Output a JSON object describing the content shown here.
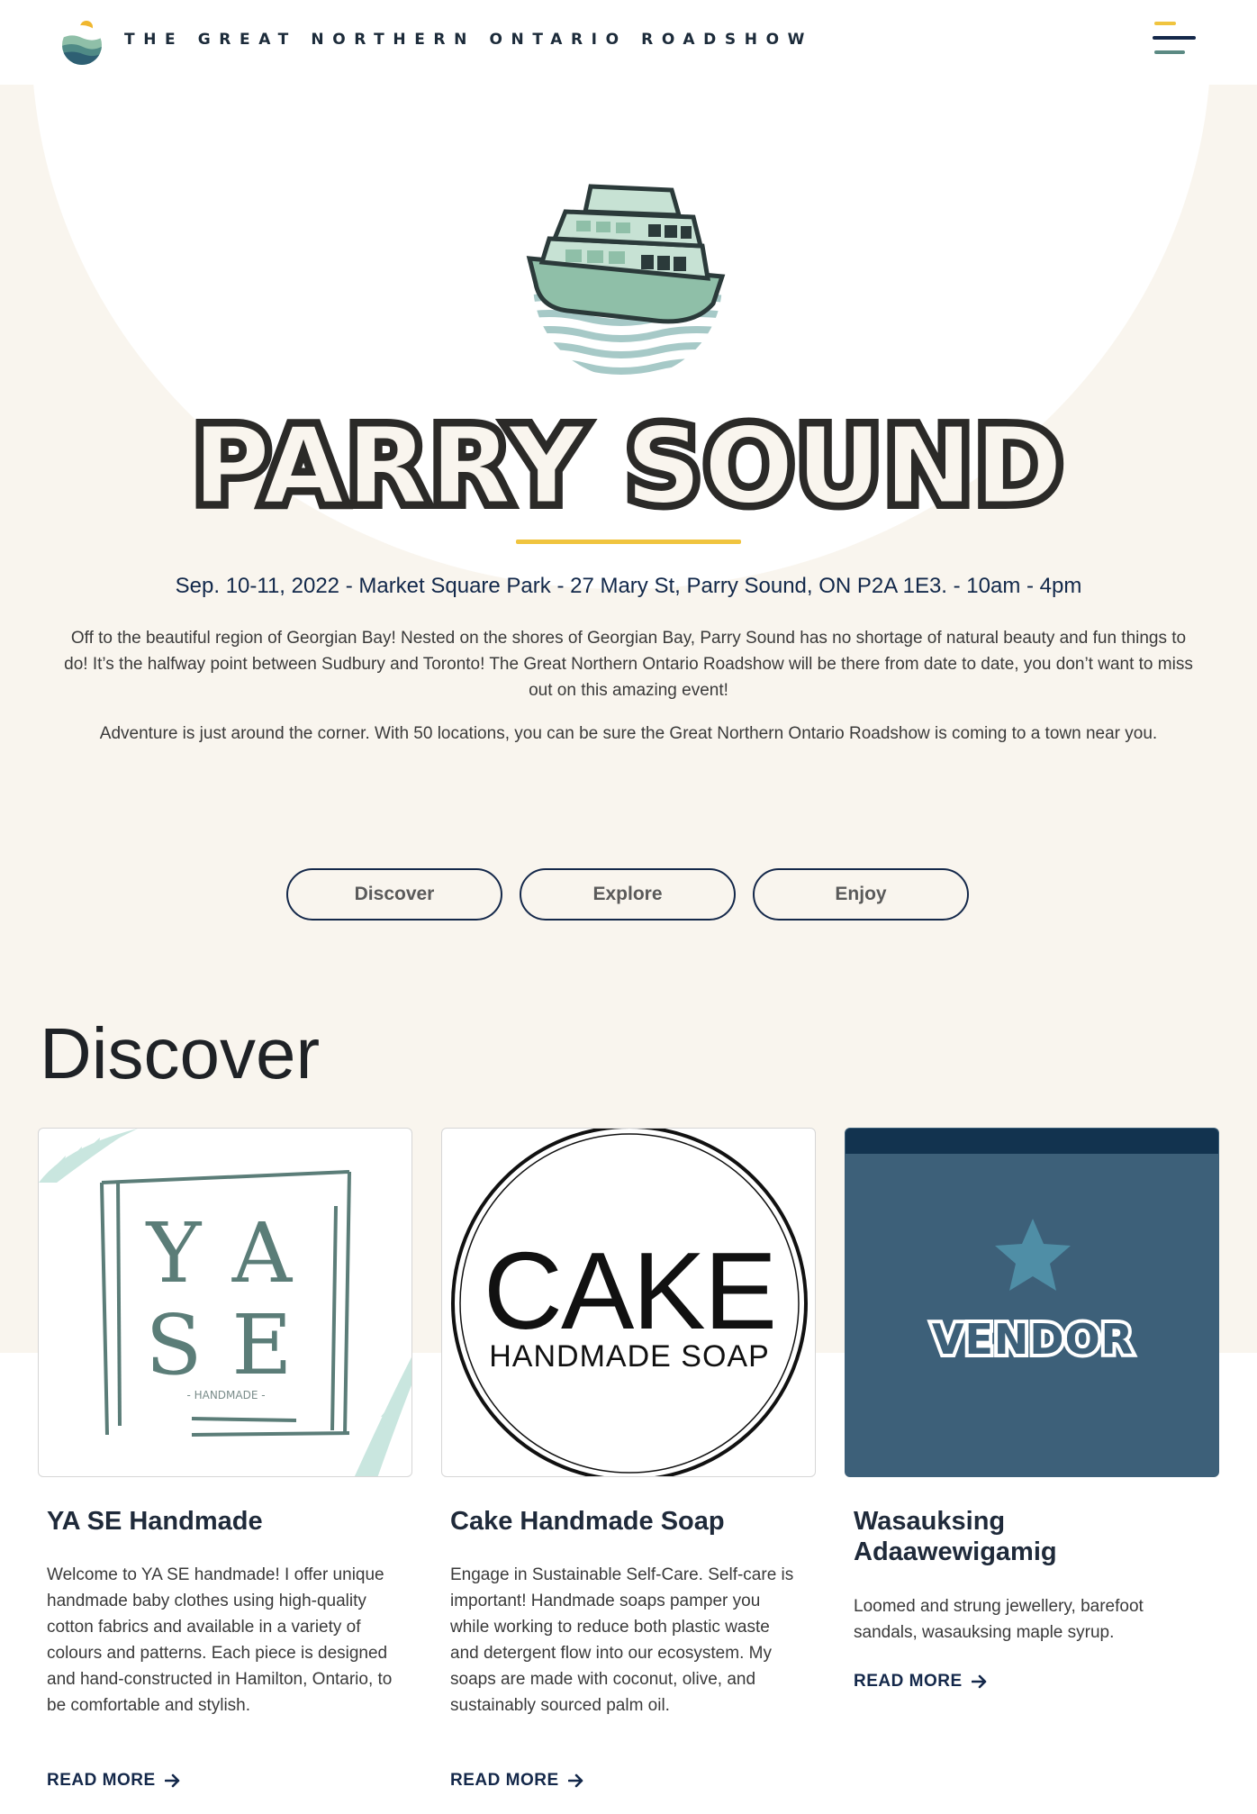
{
  "header": {
    "site_title": "THE GREAT NORTHERN ONTARIO ROADSHOW"
  },
  "hero": {
    "title": "PARRY SOUND",
    "event_info": "Sep. 10-11, 2022 - Market Square Park - 27 Mary St, Parry Sound, ON P2A 1E3. - 10am - 4pm",
    "paragraph_1": "Off to the beautiful region of Georgian Bay! Nested on the shores of Georgian Bay, Parry Sound has no shortage of natural beauty and fun things to do! It’s the halfway point between Sudbury and Toronto! The Great Northern Ontario Roadshow will be there from date to date, you don’t want to miss out on this amazing event!",
    "paragraph_2": "Adventure is just around the corner. With 50 locations, you can be sure the Great Northern Ontario Roadshow is coming to a town near you.",
    "buttons": [
      "Discover",
      "Explore",
      "Enjoy"
    ]
  },
  "discover": {
    "section_title": "Discover",
    "cards": [
      {
        "logo_text": [
          "Y",
          "A",
          "S",
          "E",
          "- HANDMADE -"
        ],
        "title": "YA SE Handmade",
        "text": "Welcome to YA SE handmade! I offer unique handmade baby clothes using high-quality cotton fabrics and available in a variety of colours and patterns. Each piece is designed and hand-constructed in Hamilton, Ontario, to be comfortable and stylish.",
        "read_more": "READ MORE"
      },
      {
        "logo_text": [
          "CAKE",
          "HANDMADE SOAP"
        ],
        "title": "Cake Handmade Soap",
        "text": "Engage in Sustainable Self-Care. Self-care is important! Handmade soaps pamper you while working to reduce both plastic waste and detergent flow into our ecosystem. My soaps are made with coconut, olive, and sustainably sourced palm oil.",
        "read_more": "READ MORE"
      },
      {
        "logo_text": [
          "VENDOR"
        ],
        "title": "Wasauksing Adaawewigamig",
        "text": "Loomed and strung jewellery, barefoot sandals, wasauksing maple syrup.",
        "read_more": "READ MORE"
      }
    ]
  },
  "colors": {
    "cream": "#f9f5ee",
    "navy": "#14284a",
    "accent_yellow": "#f0c43f",
    "vendor_blue": "#3d6079",
    "sea_green": "#8fbfa8"
  }
}
